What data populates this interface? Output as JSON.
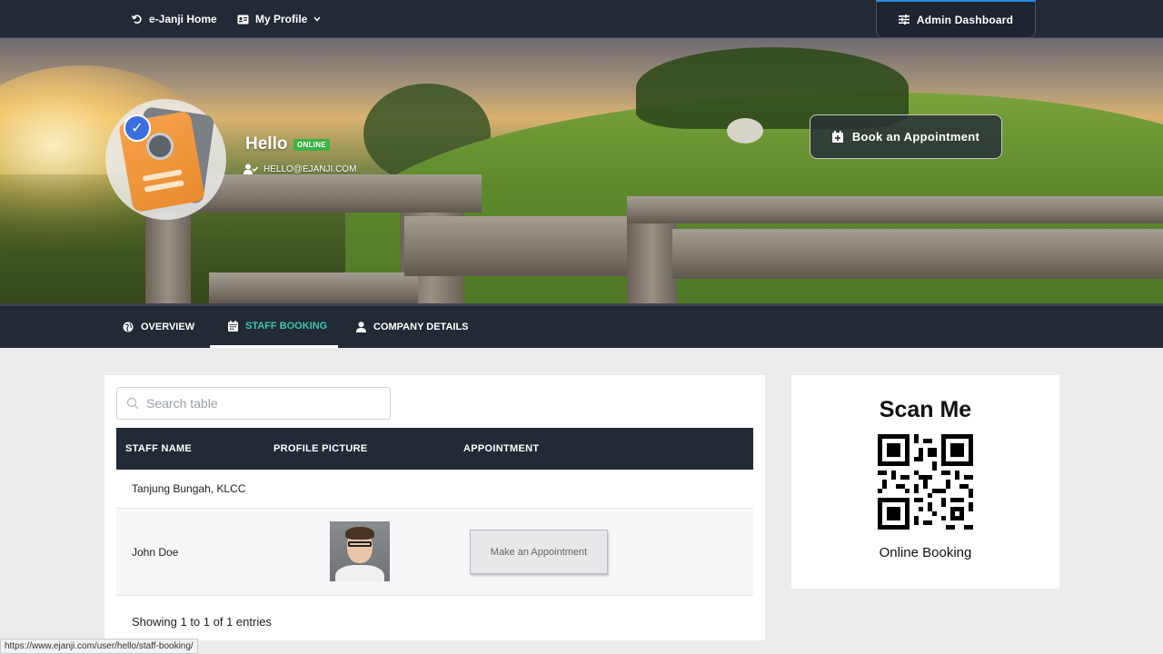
{
  "topnav": {
    "home_label": "e-Janji Home",
    "profile_label": "My Profile",
    "admin_label": "Admin Dashboard"
  },
  "hero": {
    "greeting": "Hello",
    "status_badge": "ONLINE",
    "email": "HELLO@EJANJI.COM",
    "book_label": "Book an Appointment"
  },
  "tabs": [
    {
      "label": "OVERVIEW",
      "icon": "globe-icon",
      "active": false
    },
    {
      "label": "STAFF BOOKING",
      "icon": "calendar-icon",
      "active": true
    },
    {
      "label": "COMPANY DETAILS",
      "icon": "user-icon",
      "active": false
    }
  ],
  "table": {
    "search_placeholder": "Search table",
    "headers": [
      "STAFF NAME",
      "PROFILE PICTURE",
      "APPOINTMENT"
    ],
    "group_label": "Tanjung Bungah, KLCC",
    "rows": [
      {
        "staff_name": "John Doe",
        "appointment_label": "Make an Appointment"
      }
    ],
    "footer": "Showing 1 to 1 of 1 entries"
  },
  "qr_card": {
    "title": "Scan Me",
    "caption": "Online Booking"
  },
  "status_url": "https://www.ejanji.com/user/hello/staff-booking/",
  "colors": {
    "nav_bg": "#222a36",
    "active_tab": "#39c6b4",
    "online_badge": "#3cb043",
    "page_bg": "#ececec"
  }
}
